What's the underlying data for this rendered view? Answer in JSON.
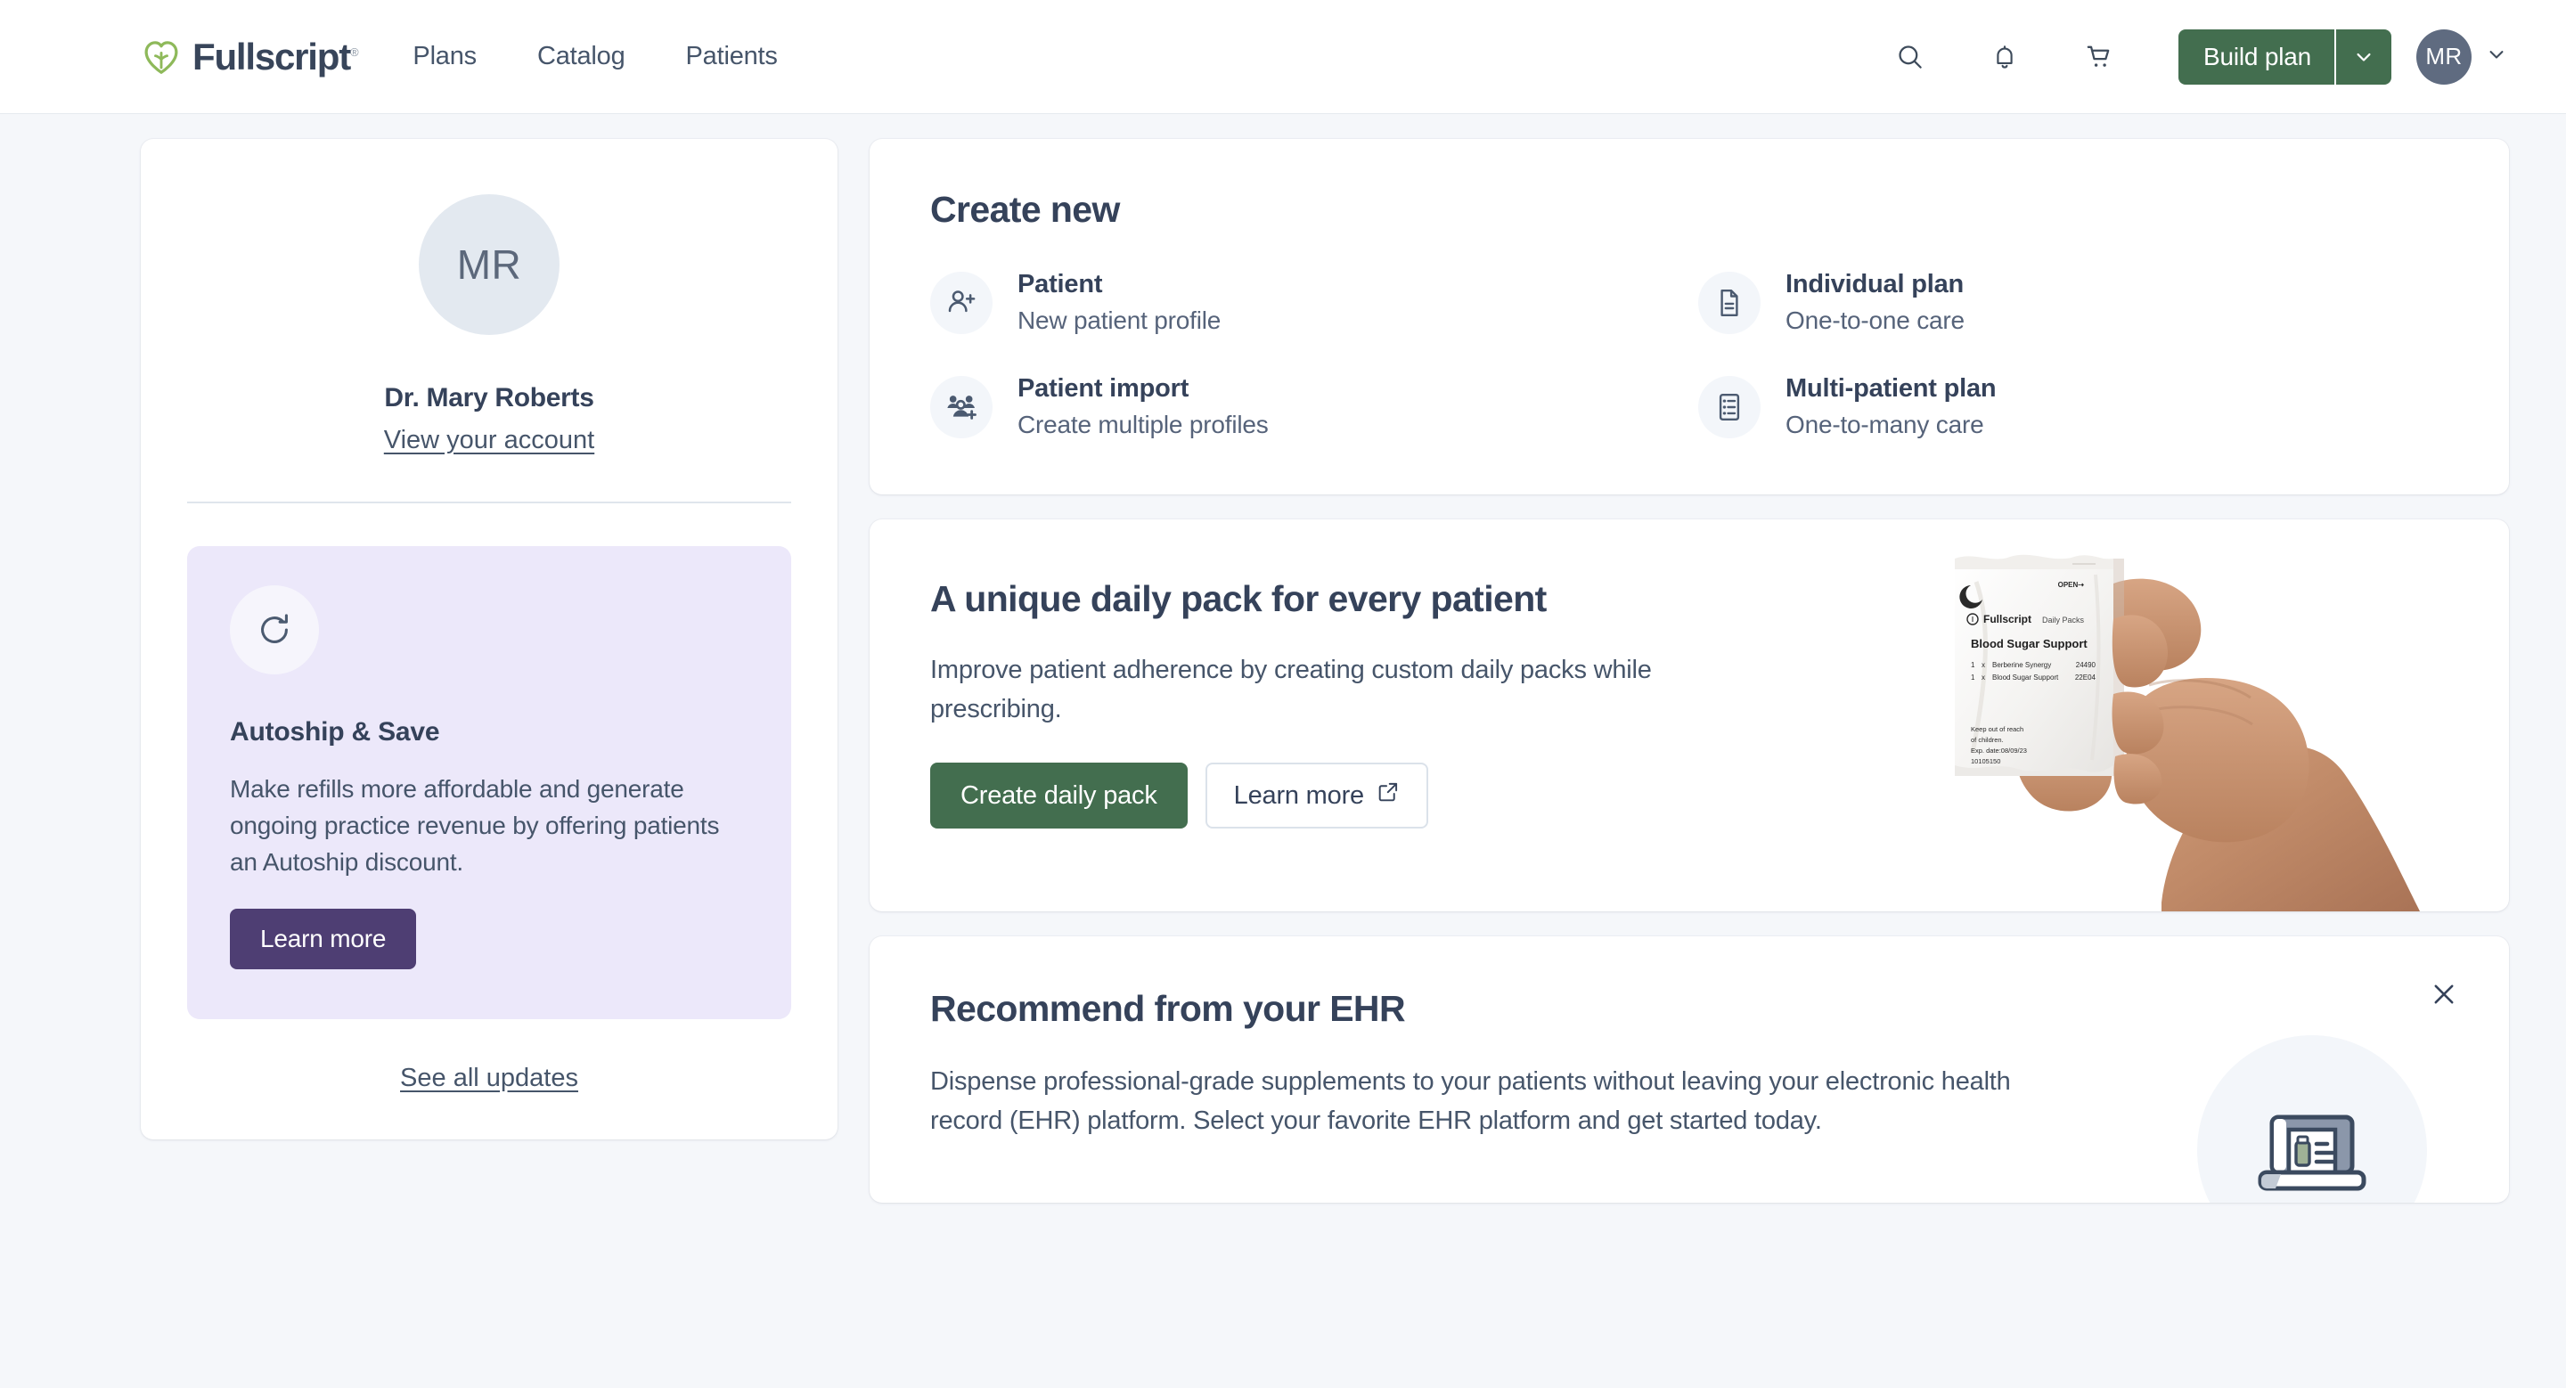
{
  "header": {
    "brand_name": "Fullscript",
    "brand_registered": "®",
    "nav": [
      {
        "label": "Plans"
      },
      {
        "label": "Catalog"
      },
      {
        "label": "Patients"
      }
    ],
    "icons": {
      "search": "search-icon",
      "notifications": "bell-icon",
      "cart": "cart-icon"
    },
    "build_plan_label": "Build plan",
    "avatar_initials": "MR",
    "colors": {
      "brand_green": "#436e4f",
      "brand_leaf": "#8eb95a",
      "avatar_bg": "#5f6b80"
    }
  },
  "profile": {
    "avatar_initials": "MR",
    "name": "Dr. Mary Roberts",
    "account_link": "View your account"
  },
  "promo": {
    "icon": "refresh-icon",
    "title": "Autoship & Save",
    "body": "Make refills more affordable and generate ongoing practice revenue by offering patients an Autoship discount.",
    "cta": "Learn more",
    "see_all": "See all updates",
    "colors": {
      "card_bg": "#ece8fa",
      "button_bg": "#4e3e73"
    }
  },
  "create_new": {
    "title": "Create new",
    "items": [
      {
        "icon": "user-plus-icon",
        "title": "Patient",
        "subtitle": "New patient profile"
      },
      {
        "icon": "document-icon",
        "title": "Individual plan",
        "subtitle": "One-to-one care"
      },
      {
        "icon": "users-plus-icon",
        "title": "Patient import",
        "subtitle": "Create multiple profiles"
      },
      {
        "icon": "checklist-icon",
        "title": "Multi-patient plan",
        "subtitle": "One-to-many care"
      }
    ]
  },
  "daily_pack": {
    "title": "A unique daily pack for every patient",
    "body": "Improve patient adherence by creating custom daily packs while prescribing.",
    "primary_cta": "Create daily pack",
    "secondary_cta": "Learn more",
    "secondary_icon": "external-link-icon",
    "image": {
      "alt": "hand-holding-daily-pack-sachet",
      "sachet_brand": "Fullscript",
      "sachet_line": "Daily Packs",
      "sachet_open": "OPEN",
      "sachet_title": "Blood Sugar Support",
      "sachet_items": [
        {
          "qty": "1",
          "x": "x",
          "name": "Berberine Synergy",
          "code": "24490"
        },
        {
          "qty": "1",
          "x": "x",
          "name": "Blood Sugar Support",
          "code": "22E04"
        }
      ],
      "sachet_warning_1": "Keep out of reach",
      "sachet_warning_2": "of children.",
      "sachet_warning_3": "Exp. date:08/09/23",
      "sachet_warning_4": "10105150"
    },
    "colors": {
      "button_bg": "#436e4f"
    }
  },
  "ehr": {
    "title": "Recommend from your EHR",
    "body": "Dispense professional-grade supplements to your patients without leaving your electronic health record (EHR) platform. Select your favorite EHR platform and get started today.",
    "close_icon": "close-icon",
    "illustration": "laptop-supplement-icon"
  },
  "theme": {
    "page_bg": "#f5f7fa",
    "card_bg": "#ffffff",
    "text_dark": "#35425a",
    "text_body": "#46556a",
    "icon_circle_bg": "#f3f6fa"
  }
}
